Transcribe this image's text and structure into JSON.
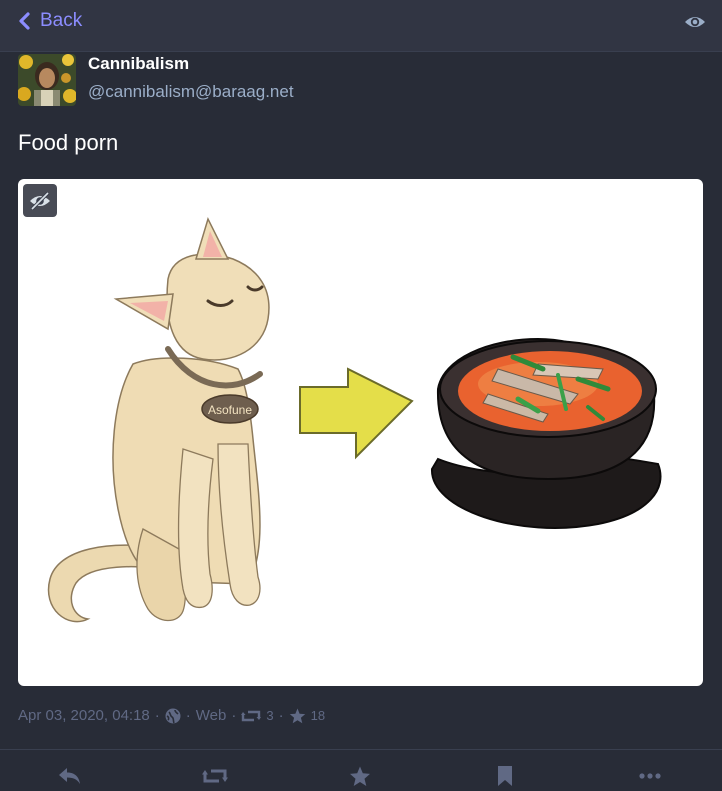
{
  "header": {
    "back_label": "Back"
  },
  "account": {
    "display_name": "Cannibalism",
    "handle": "@cannibalism@baraag.net"
  },
  "status": {
    "text": "Food porn"
  },
  "media": {
    "cat_tag_text": "Asofune"
  },
  "meta": {
    "date": "Apr 03, 2020, 04:18",
    "separator": "·",
    "application": "Web",
    "reblogs_count": "3",
    "favourites_count": "18"
  },
  "colors": {
    "accent": "#8c8dff",
    "background": "#282c37",
    "header_background": "#313543",
    "muted_text": "#606984",
    "secondary_text": "#9baec8"
  },
  "icons": {
    "back": "chevron-left-icon",
    "visibility": "eye-icon",
    "hide_media": "eye-slash-icon",
    "privacy": "globe-icon",
    "reblog": "retweet-icon",
    "favourite": "star-icon",
    "reply": "reply-icon",
    "bookmark": "bookmark-icon",
    "more": "ellipsis-icon"
  }
}
